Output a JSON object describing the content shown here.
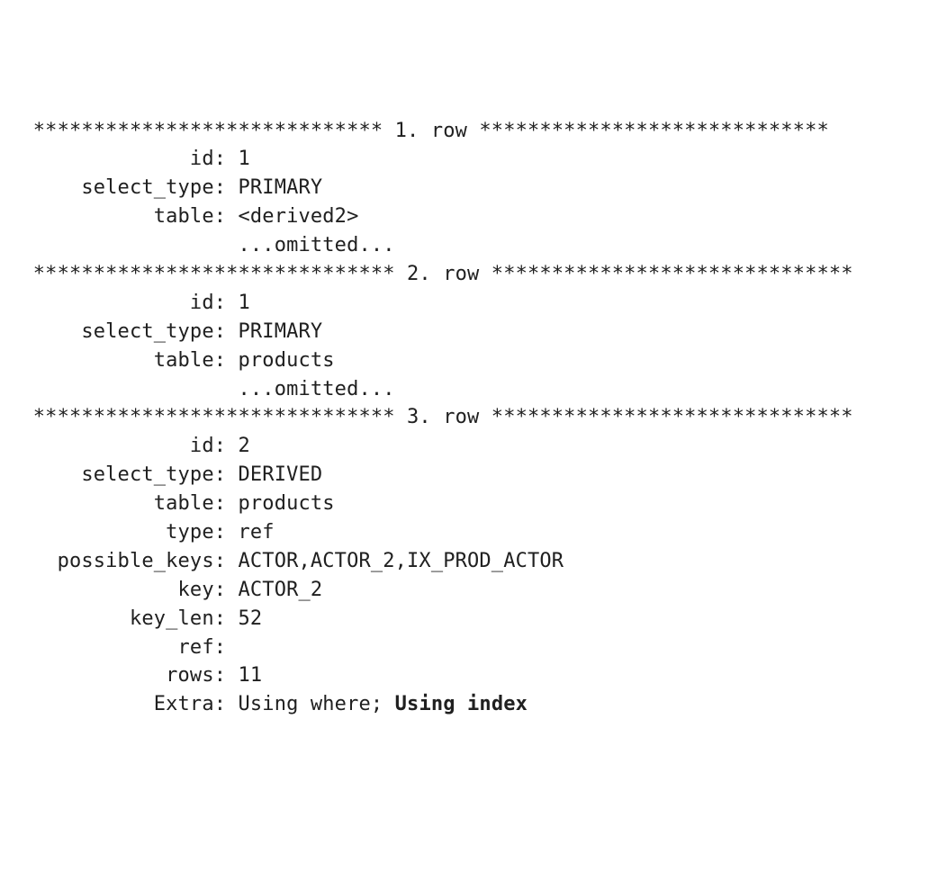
{
  "starsA": "*****************************",
  "starsB": "*****************************",
  "starsC": "******************************",
  "starsD": "******************************",
  "starsE": "******************************",
  "starsF": "******************************",
  "rowLabel": "row",
  "omitted": "...omitted...",
  "labels": {
    "id": "id",
    "select_type": "select_type",
    "table": "table",
    "type": "type",
    "possible_keys": "possible_keys",
    "key": "key",
    "key_len": "key_len",
    "ref": "ref",
    "rows": "rows",
    "Extra": "Extra"
  },
  "rows": [
    {
      "n": "1.",
      "fields": {
        "id": "1",
        "select_type": "PRIMARY",
        "table": "<derived2>"
      }
    },
    {
      "n": "2.",
      "fields": {
        "id": "1",
        "select_type": "PRIMARY",
        "table": "products"
      }
    },
    {
      "n": "3.",
      "fields": {
        "id": "2",
        "select_type": "DERIVED",
        "table": "products",
        "type": "ref",
        "possible_keys": "ACTOR,ACTOR_2,IX_PROD_ACTOR",
        "key": "ACTOR_2",
        "key_len": "52",
        "ref": "",
        "rows": "11"
      },
      "extra_plain": "Using where; ",
      "extra_bold": "Using index"
    }
  ]
}
